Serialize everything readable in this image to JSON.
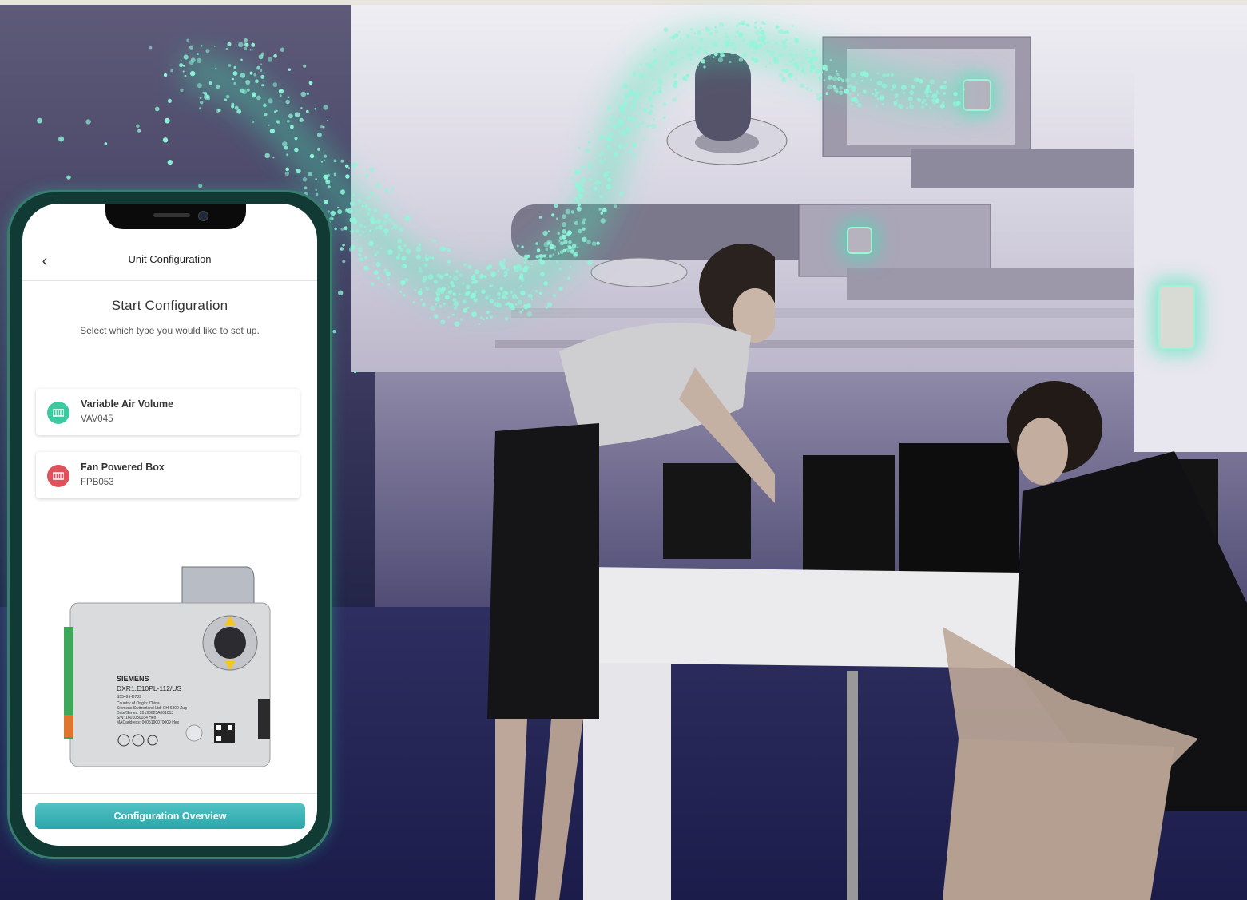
{
  "app": {
    "screen_title": "Unit Configuration",
    "heading": "Start Configuration",
    "subheading": "Select which type you would like to set up.",
    "options": [
      {
        "name": "Variable Air Volume",
        "code": "VAV045",
        "accent": "#3cc9a0"
      },
      {
        "name": "Fan Powered Box",
        "code": "FPB053",
        "accent": "#e0505a"
      }
    ],
    "primary_action": "Configuration Overview"
  },
  "device": {
    "brand": "SIEMENS",
    "model": "DXR1.E10PL-112/US",
    "part": "S55499-D789",
    "lines": [
      "Country of Origin: China",
      "Siemens Switzerland Ltd, CH-6300 Zug",
      "Date/Series: 20190625A001013",
      "S/N: 1601030034 Hex",
      "MACaddress: 0005190070009 Hex"
    ]
  },
  "colors": {
    "accent_teal": "#2ba6a9",
    "particle_glow": "#5ef0c0",
    "phone_frame": "#113a34"
  }
}
